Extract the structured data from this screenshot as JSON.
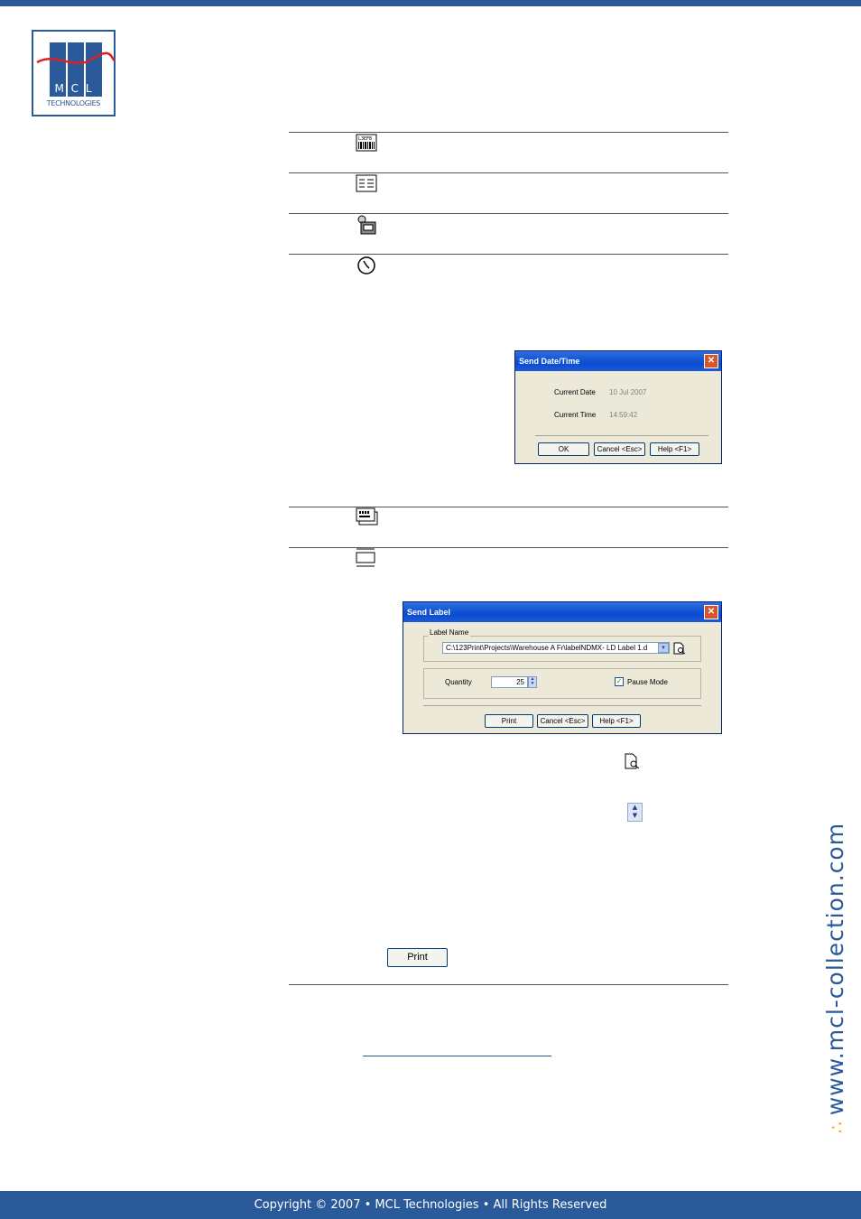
{
  "header": {
    "brand_color": "#2a5a9a"
  },
  "logo": {
    "letters": "M C L",
    "subtitle": "TECHNOLOGIES"
  },
  "icons": [
    "barcode-label-icon",
    "list-icon",
    "config-icon",
    "clock-icon",
    "label-stack-icon",
    "label-frame-icon"
  ],
  "send_datetime": {
    "title": "Send Date/Time",
    "date_label": "Current Date",
    "date_value": "10 Jul 2007",
    "time_label": "Current Time",
    "time_value": "14:59:42",
    "ok": "OK",
    "cancel": "Cancel <Esc>",
    "help": "Help <F1>"
  },
  "send_label": {
    "title": "Send Label",
    "group_label": "Label Name",
    "path": "C:\\123Print\\Projects\\Warehouse A Fr\\labelNDMX- LD Label 1.d",
    "quantity_label": "Quantity",
    "quantity_value": "25",
    "pause_label": "Pause Mode",
    "print": "Print",
    "cancel": "Cancel <Esc>",
    "help": "Help <F1>"
  },
  "inline_print_button": "Print",
  "sidebar": {
    "url": "www.mcl-collection.com",
    "dots": "∴"
  },
  "footer": {
    "text": "Copyright © 2007 • MCL Technologies • All Rights Reserved"
  }
}
